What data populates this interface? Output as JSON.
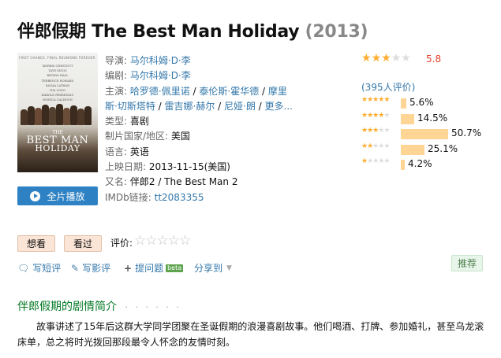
{
  "title": {
    "chinese": "伴郎假期",
    "english": "The Best Man Holiday",
    "year": "(2013)"
  },
  "poster": {
    "tagline": "FIRST CHANCE. FINAL REUNIONS FOREVER.",
    "cast_lines": [
      "MORRIS CHESTNUT",
      "TAYE DIGGS",
      "REGINA HALL",
      "TERRENCE HOWARD",
      "SANAA LATHAN",
      "NIA LONG",
      "HAROLD PERRINEAU",
      "MONICA CALHOUN",
      "MELISSA DE SOUSA"
    ],
    "movie_title_line1": "THE",
    "movie_title_line2": "BEST MAN",
    "movie_title_line3": "HOLIDAY"
  },
  "play_button": {
    "label": "全片播放"
  },
  "info": {
    "director": {
      "label": "导演:",
      "value": "马尔科姆·D·李"
    },
    "writer": {
      "label": "编剧:",
      "value": "马尔科姆·D·李"
    },
    "cast": {
      "label": "主演:",
      "names": [
        "哈罗德·佩里诺",
        "泰伦斯·霍华德",
        "摩里斯·切斯塔特",
        "雷吉娜·赫尔",
        "尼娅·朗"
      ],
      "more": "更多...",
      "sep": " / "
    },
    "genre": {
      "label": "类型:",
      "value": "喜剧"
    },
    "country": {
      "label": "制片国家/地区:",
      "value": "美国"
    },
    "language": {
      "label": "语言:",
      "value": "英语"
    },
    "release": {
      "label": "上映日期:",
      "value": "2013-11-15(美国)"
    },
    "aka": {
      "label": "又名:",
      "value": "伴郎2 / The Best Man 2"
    },
    "imdb": {
      "label": "IMDb链接:",
      "value": "tt2083355"
    }
  },
  "rating": {
    "score": "5.8",
    "stars_filled": 3,
    "count_text": "(395人评价)",
    "distribution": [
      {
        "stars": 5,
        "pct_label": "5.6%",
        "fraction": 0.056
      },
      {
        "stars": 4,
        "pct_label": "14.5%",
        "fraction": 0.145
      },
      {
        "stars": 3,
        "pct_label": "50.7%",
        "fraction": 0.507
      },
      {
        "stars": 2,
        "pct_label": "25.1%",
        "fraction": 0.251
      },
      {
        "stars": 1,
        "pct_label": "4.2%",
        "fraction": 0.042
      }
    ],
    "star_color": "#ffac2d",
    "score_color": "#e5412b"
  },
  "actions": {
    "want": "想看",
    "seen": "看过",
    "rate_label": "评价:",
    "rate_stars": "☆☆☆☆☆"
  },
  "tools": {
    "short_review": "写短评",
    "review": "写影评",
    "ask": "提问题",
    "beta": "beta",
    "share": "分享到",
    "recommend": "推荐"
  },
  "synopsis": {
    "heading": "伴郎假期的剧情简介",
    "dots": "· · · · · ·",
    "text": "故事讲述了15年后这群大学同学团聚在圣诞假期的浪漫喜剧故事。他们喝酒、打牌、参加婚礼，甚至乌龙滚床单，总之将时光拨回那段最令人怀念的友情时刻。"
  }
}
